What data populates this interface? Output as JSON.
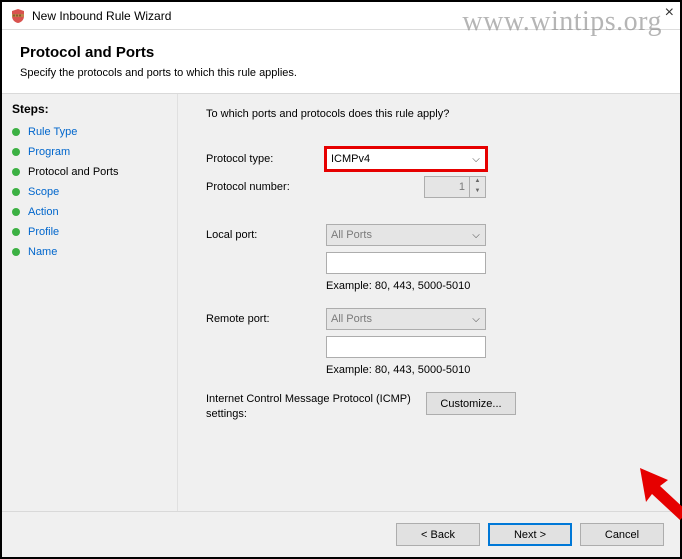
{
  "window": {
    "title": "New Inbound Rule Wizard",
    "watermark": "www.wintips.org"
  },
  "header": {
    "title": "Protocol and Ports",
    "subtitle": "Specify the protocols and ports to which this rule applies."
  },
  "sidebar": {
    "label": "Steps:",
    "items": [
      {
        "label": "Rule Type",
        "current": false
      },
      {
        "label": "Program",
        "current": false
      },
      {
        "label": "Protocol and Ports",
        "current": true
      },
      {
        "label": "Scope",
        "current": false
      },
      {
        "label": "Action",
        "current": false
      },
      {
        "label": "Profile",
        "current": false
      },
      {
        "label": "Name",
        "current": false
      }
    ]
  },
  "content": {
    "prompt": "To which ports and protocols does this rule apply?",
    "protocol_type_label": "Protocol type:",
    "protocol_type_value": "ICMPv4",
    "protocol_number_label": "Protocol number:",
    "protocol_number_value": "1",
    "local_port_label": "Local port:",
    "local_port_value": "All Ports",
    "local_port_text": "",
    "local_port_hint": "Example: 80, 443, 5000-5010",
    "remote_port_label": "Remote port:",
    "remote_port_value": "All Ports",
    "remote_port_text": "",
    "remote_port_hint": "Example: 80, 443, 5000-5010",
    "icmp_label": "Internet Control Message Protocol (ICMP) settings:",
    "customize_label": "Customize..."
  },
  "footer": {
    "back": "< Back",
    "next": "Next >",
    "cancel": "Cancel"
  }
}
